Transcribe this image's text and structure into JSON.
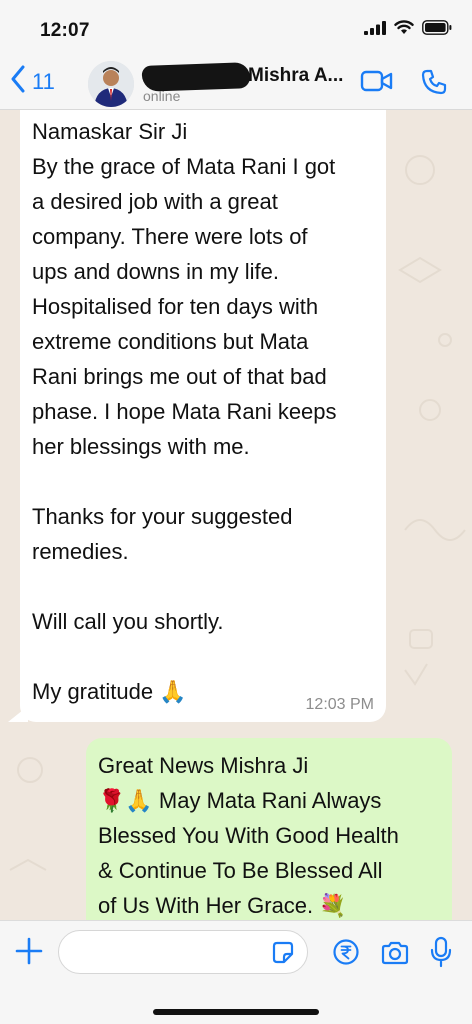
{
  "status_bar": {
    "time": "12:07",
    "icons": [
      "signal-icon",
      "wifi-icon",
      "battery-icon"
    ]
  },
  "header": {
    "back_count": "11",
    "contact_name": "Mishra A...",
    "contact_status": "online",
    "icons": [
      "back-chevron-icon",
      "video-call-icon",
      "phone-call-icon"
    ]
  },
  "messages": [
    {
      "direction": "incoming",
      "text": "Namaskar Sir Ji\nBy the grace of Mata Rani I got\na desired job with a great\ncompany. There were lots of\nups and downs in my life.\nHospitalised for ten days with\nextreme conditions but Mata\nRani brings me out of that bad\nphase. I hope Mata Rani keeps\nher blessings with me.\n\nThanks for your suggested\nremedies.\n\nWill call you shortly.\n\nMy gratitude",
      "emoji": "🙏",
      "time": "12:03 PM"
    },
    {
      "direction": "outgoing",
      "line1": "Great News Mishra Ji",
      "emoji_lead": "🌹🙏",
      "line2": " May Mata Rani Always",
      "line3": "Blessed You With Good Health",
      "line4": "& Continue To Be Blessed All",
      "line5": "of Us With Her Grace.",
      "emoji_trail": "💐"
    }
  ],
  "input_bar": {
    "placeholder": "",
    "icons": [
      "plus-icon",
      "sticker-icon",
      "rupee-icon",
      "camera-icon",
      "microphone-icon"
    ]
  },
  "colors": {
    "accent": "#1a7cf5",
    "chat_background": "#efe7de",
    "incoming_bubble": "#ffffff",
    "outgoing_bubble": "#dcf8c6"
  }
}
